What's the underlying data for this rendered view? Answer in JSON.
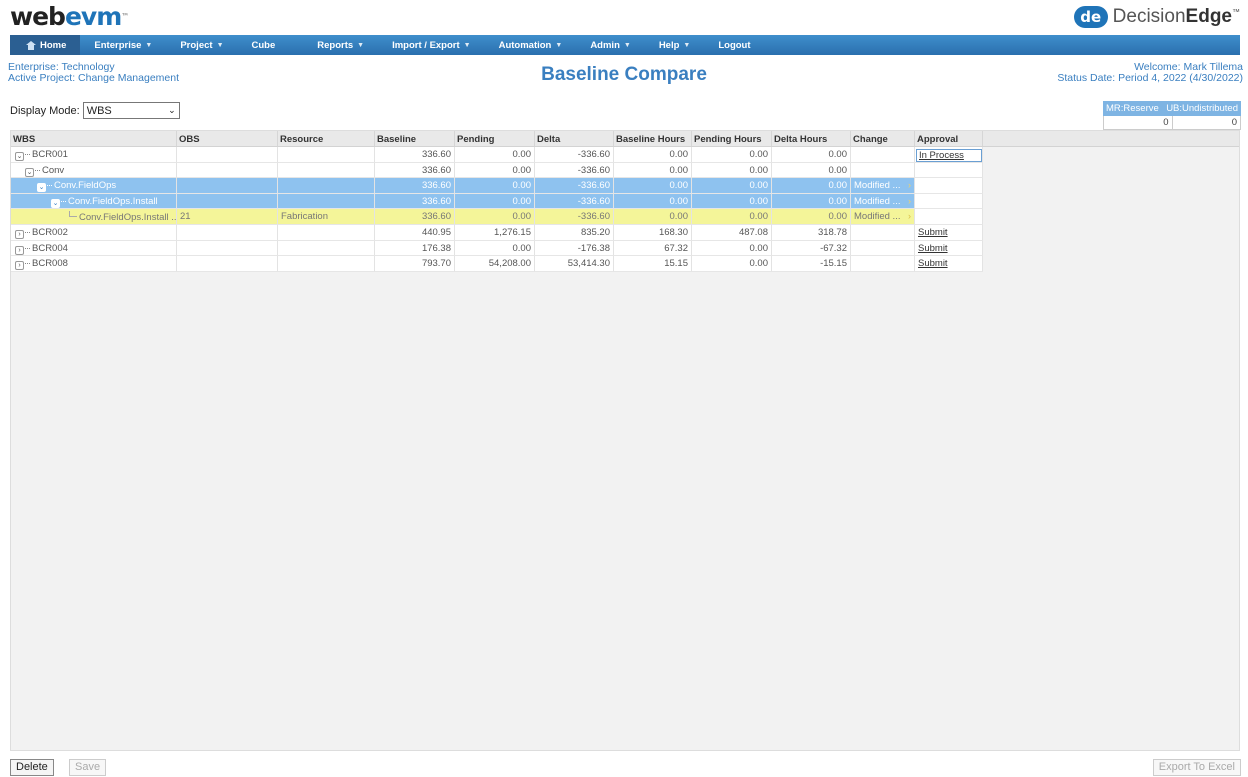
{
  "app": {
    "logo_a": "web",
    "logo_b": "evm",
    "logo_tm": "™",
    "brand_mark": "de",
    "brand_a": "Decision",
    "brand_b": "Edge",
    "brand_tm": "™"
  },
  "nav": [
    {
      "label": "Home",
      "dropdown": false
    },
    {
      "label": "Enterprise",
      "dropdown": true
    },
    {
      "label": "Project",
      "dropdown": true
    },
    {
      "label": "Cube",
      "dropdown": false
    },
    {
      "label": "Reports",
      "dropdown": true
    },
    {
      "label": "Import / Export",
      "dropdown": true
    },
    {
      "label": "Automation",
      "dropdown": true
    },
    {
      "label": "Admin",
      "dropdown": true
    },
    {
      "label": "Help",
      "dropdown": true
    },
    {
      "label": "Logout",
      "dropdown": false
    }
  ],
  "header": {
    "enterprise": "Enterprise: Technology",
    "active_project": "Active Project: Change Management",
    "title": "Baseline Compare",
    "welcome": "Welcome: Mark Tillema",
    "status_date": "Status Date: Period 4, 2022 (4/30/2022)"
  },
  "display_mode": {
    "label": "Display Mode:",
    "value": "WBS"
  },
  "mr_box": {
    "mr_label": "MR:Reserve",
    "ub_label": "UB:Undistributed",
    "mr_value": "0",
    "ub_value": "0"
  },
  "grid": {
    "columns": [
      "WBS",
      "OBS",
      "Resource",
      "Baseline",
      "Pending",
      "Delta",
      "Baseline Hours",
      "Pending Hours",
      "Delta Hours",
      "Change",
      "Approval"
    ],
    "rows": [
      {
        "wbs": "BCR001",
        "obs": "",
        "resource": "",
        "baseline": "336.60",
        "pending": "0.00",
        "delta": "-336.60",
        "baseline_hours": "0.00",
        "pending_hours": "0.00",
        "delta_hours": "0.00",
        "change": "",
        "approval": "In Process"
      },
      {
        "wbs": "Conv",
        "obs": "",
        "resource": "",
        "baseline": "336.60",
        "pending": "0.00",
        "delta": "-336.60",
        "baseline_hours": "0.00",
        "pending_hours": "0.00",
        "delta_hours": "0.00",
        "change": "",
        "approval": ""
      },
      {
        "wbs": "Conv.FieldOps",
        "obs": "",
        "resource": "",
        "baseline": "336.60",
        "pending": "0.00",
        "delta": "-336.60",
        "baseline_hours": "0.00",
        "pending_hours": "0.00",
        "delta_hours": "0.00",
        "change": "Modified ...",
        "approval": ""
      },
      {
        "wbs": "Conv.FieldOps.Install",
        "obs": "",
        "resource": "",
        "baseline": "336.60",
        "pending": "0.00",
        "delta": "-336.60",
        "baseline_hours": "0.00",
        "pending_hours": "0.00",
        "delta_hours": "0.00",
        "change": "Modified ...",
        "approval": ""
      },
      {
        "wbs": "Conv.FieldOps.Install ...",
        "obs": "21",
        "resource": "Fabrication",
        "baseline": "336.60",
        "pending": "0.00",
        "delta": "-336.60",
        "baseline_hours": "0.00",
        "pending_hours": "0.00",
        "delta_hours": "0.00",
        "change": "Modified ...",
        "approval": ""
      },
      {
        "wbs": "BCR002",
        "obs": "",
        "resource": "",
        "baseline": "440.95",
        "pending": "1,276.15",
        "delta": "835.20",
        "baseline_hours": "168.30",
        "pending_hours": "487.08",
        "delta_hours": "318.78",
        "change": "",
        "approval": "Submit"
      },
      {
        "wbs": "BCR004",
        "obs": "",
        "resource": "",
        "baseline": "176.38",
        "pending": "0.00",
        "delta": "-176.38",
        "baseline_hours": "67.32",
        "pending_hours": "0.00",
        "delta_hours": "-67.32",
        "change": "",
        "approval": "Submit"
      },
      {
        "wbs": "BCR008",
        "obs": "",
        "resource": "",
        "baseline": "793.70",
        "pending": "54,208.00",
        "delta": "53,414.30",
        "baseline_hours": "15.15",
        "pending_hours": "0.00",
        "delta_hours": "-15.15",
        "change": "",
        "approval": "Submit"
      }
    ]
  },
  "footer": {
    "delete": "Delete",
    "save": "Save",
    "export": "Export To Excel"
  },
  "colors": {
    "accent": "#3a7fc0",
    "selected_row": "#8ec2ef",
    "highlight_row": "#f4f599"
  }
}
